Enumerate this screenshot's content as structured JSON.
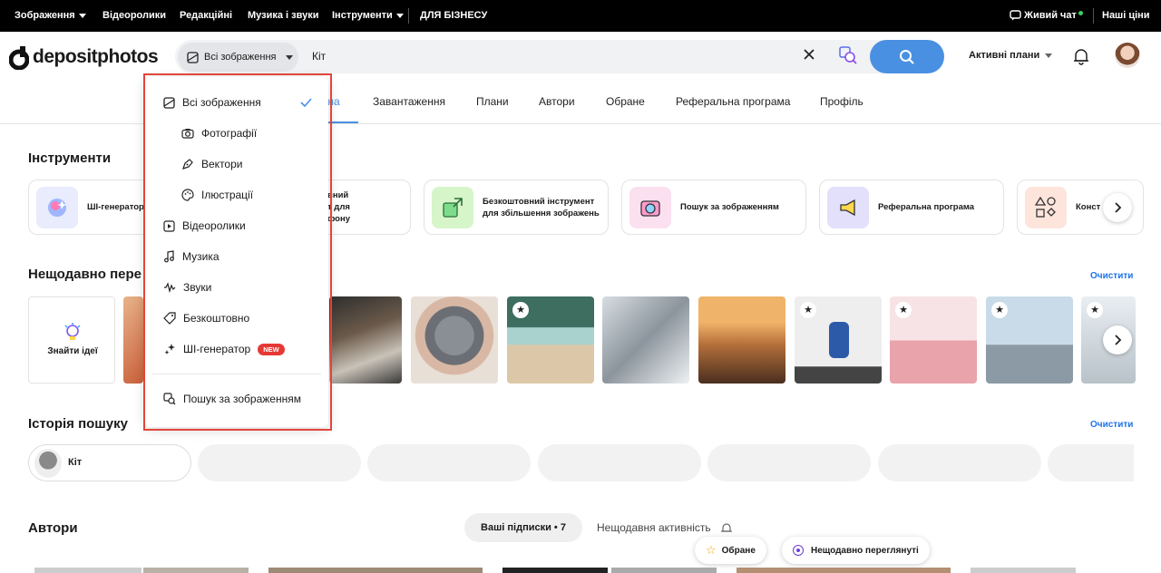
{
  "topbar": {
    "items": [
      "Зображення",
      "Відеоролики",
      "Редакційні",
      "Музика і звуки",
      "Інструменти",
      "ДЛЯ БІЗНЕСУ"
    ],
    "live_chat": "Живий чат",
    "prices": "Наші ціни"
  },
  "header": {
    "logo": "depositphotos",
    "scope_label": "Всі зображення",
    "search_value": "Кіт",
    "plans_label": "Активні плани"
  },
  "nav": {
    "tabs": [
      "Головна",
      "Завантаження",
      "Плани",
      "Автори",
      "Обране",
      "Реферальна програма",
      "Профіль"
    ],
    "active_visible": "вна"
  },
  "tools": {
    "title": "Інструменти",
    "cards": [
      "ШІ-генератор",
      "Безкоштовний інструмент для видалення фону",
      "Безкоштовний інструмент для збільшення зображень",
      "Пошук за зображенням",
      "Реферальна програма",
      "Конст"
    ],
    "card2_visible": [
      "вний",
      "т для",
      "фону"
    ]
  },
  "recent": {
    "title": "Нещодавно переглянуті",
    "title_visible": "Нещодавно пере",
    "clear": "Очистити",
    "ideas": "Знайти ідеї"
  },
  "history": {
    "title": "Історія пошуку",
    "clear": "Очистити",
    "query": "Кіт"
  },
  "authors": {
    "title": "Автори",
    "subscriptions": "Ваші підписки • 7",
    "recent_activity": "Нещодавня активність"
  },
  "floating": {
    "favorites": "Обране",
    "recently_viewed": "Нещодавно переглянуті"
  },
  "dropdown": {
    "items": [
      "Всі зображення",
      "Фотографії",
      "Вектори",
      "Ілюстрації",
      "Відеоролики",
      "Музика",
      "Звуки",
      "Безкоштовно",
      "ШІ-генератор",
      "Пошук за зображенням"
    ],
    "badge": "NEW",
    "selected": "Всі зображення"
  },
  "colors": {
    "accent": "#4a90e2",
    "badge": "#e53935",
    "link": "#1e73e8",
    "highlight": "#e2453c"
  }
}
